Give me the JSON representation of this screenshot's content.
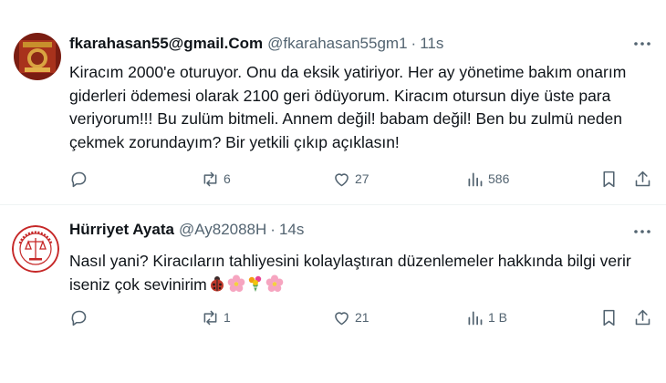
{
  "tweets": [
    {
      "display_name": "fkarahasan55@gmail.Com",
      "handle": "@fkarahasan55gm1",
      "separator": "·",
      "time": "11s",
      "avatar_icon": "seal-avatar-icon",
      "text": "Kiracım 2000'e oturuyor. Onu da eksik yatiriyor. Her ay yönetime bakım onarım giderleri ödemesi olarak 2100 geri ödüyorum. Kiracım otursun diye üste para veriyorum!!! Bu zulüm bitmeli. Annem değil! babam değil! Ben bu zulmü neden çekmek zorundayım? Bir yetkili çıkıp açıklasın!",
      "emojis": [],
      "stats": {
        "replies": "",
        "retweets": "6",
        "likes": "27",
        "views": "586"
      }
    },
    {
      "display_name": "Hürriyet Ayata",
      "handle": "@Ay82088H",
      "separator": "·",
      "time": "14s",
      "avatar_icon": "association-logo-avatar-icon",
      "text": "Nasıl yani? Kiracıların tahliyesini kolaylaştıran düzenlemeler hakkında bilgi verir iseniz çok sevinirim",
      "emojis": [
        "ladybug-emoji",
        "cherry-blossom-emoji",
        "bouquet-emoji",
        "cherry-blossom-emoji"
      ],
      "stats": {
        "replies": "",
        "retweets": "1",
        "likes": "21",
        "views": "1 B"
      }
    }
  ],
  "colors": {
    "text": "#0f1419",
    "secondary": "#536471",
    "divider": "#eff3f4",
    "background": "#ffffff"
  }
}
